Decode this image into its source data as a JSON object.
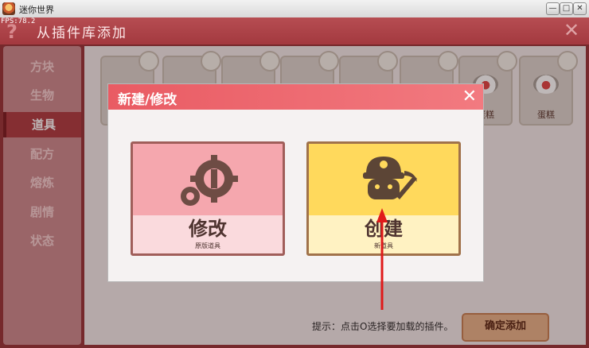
{
  "window": {
    "title": "迷你世界",
    "fps": "FPS:78.2"
  },
  "header": {
    "help": "?",
    "title": "从插件库添加",
    "close": "✕"
  },
  "sidebar": {
    "items": [
      {
        "label": "方块",
        "active": false
      },
      {
        "label": "生物",
        "active": false
      },
      {
        "label": "道具",
        "active": true
      },
      {
        "label": "配方",
        "active": false
      },
      {
        "label": "熔炼",
        "active": false
      },
      {
        "label": "剧情",
        "active": false
      },
      {
        "label": "状态",
        "active": false
      }
    ]
  },
  "slots": {
    "cake1": "蛋糕",
    "cake2": "蛋糕"
  },
  "footer": {
    "hint": "提示：点击O选择要加载的插件。",
    "confirm": "确定添加"
  },
  "dialog": {
    "title": "新建/修改",
    "close": "✕",
    "edit": {
      "label": "修改",
      "sub": "原版道具"
    },
    "create": {
      "label": "创建",
      "sub": "新道具"
    }
  },
  "colors": {
    "accent": "#e95b63",
    "edit_card": "#f5a7ae",
    "create_card": "#ffd95c",
    "arrow": "#e01a1a"
  }
}
